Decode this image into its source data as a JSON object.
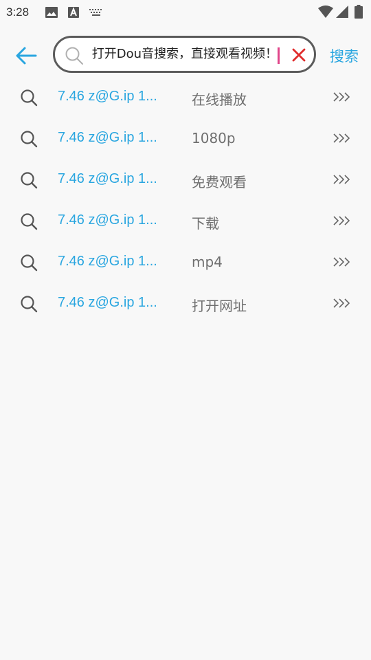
{
  "status_bar": {
    "time": "3:28",
    "icons": [
      "image-icon",
      "text-a-icon",
      "keyboard-icon",
      "wifi-icon",
      "signal-icon",
      "battery-icon"
    ]
  },
  "header": {
    "back_icon": "arrow-left-icon",
    "search": {
      "value": "打开Dou音搜索，直接观看视频！",
      "search_icon": "search-icon",
      "clear_icon": "close-icon"
    },
    "search_button": "搜索"
  },
  "suggestions": [
    {
      "query": "7.46 z@G.ip 1...",
      "suffix": "在线播放"
    },
    {
      "query": "7.46 z@G.ip 1...",
      "suffix": "1080p"
    },
    {
      "query": "7.46 z@G.ip 1...",
      "suffix": "免费观看"
    },
    {
      "query": "7.46 z@G.ip 1...",
      "suffix": "下载"
    },
    {
      "query": "7.46 z@G.ip 1...",
      "suffix": "mp4"
    },
    {
      "query": "7.46 z@G.ip 1...",
      "suffix": "打开网址"
    }
  ],
  "colors": {
    "accent": "#2aa6e0",
    "clear": "#e02b2b",
    "caret": "#e0458a",
    "background": "#f8f8f8"
  }
}
